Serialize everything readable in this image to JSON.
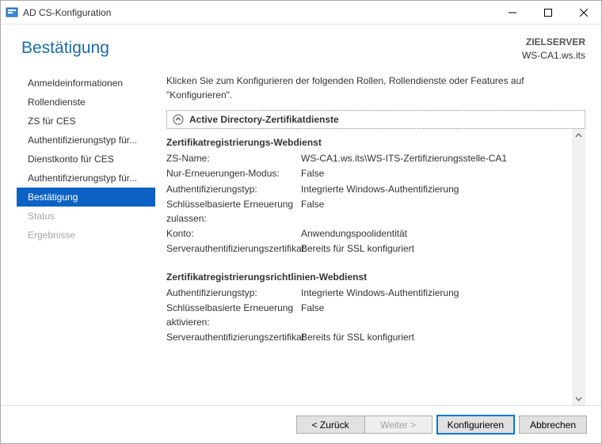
{
  "window": {
    "title": "AD CS-Konfiguration"
  },
  "header": {
    "page_title": "Bestätigung",
    "target_label": "ZIELSERVER",
    "target_value": "WS-CA1.ws.its"
  },
  "sidebar": {
    "items": [
      {
        "label": "Anmeldeinformationen"
      },
      {
        "label": "Rollendienste"
      },
      {
        "label": "ZS für CES"
      },
      {
        "label": "Authentifizierungstyp für..."
      },
      {
        "label": "Dienstkonto für CES"
      },
      {
        "label": "Authentifizierungstyp für..."
      },
      {
        "label": "Bestätigung"
      },
      {
        "label": "Status"
      },
      {
        "label": "Ergebnisse"
      }
    ]
  },
  "content": {
    "intro": "Klicken Sie zum Konfigurieren der folgenden Rollen, Rollendienste oder Features auf \"Konfigurieren\".",
    "group_title": "Active Directory-Zertifikatdienste",
    "section1": {
      "title": "Zertifikatregistrierungs-Webdienst",
      "rows": [
        {
          "k": "ZS-Name:",
          "v": "WS-CA1.ws.its\\WS-ITS-Zertifizierungsstelle-CA1"
        },
        {
          "k": "Nur-Erneuerungen-Modus:",
          "v": "False"
        },
        {
          "k": "Authentifizierungstyp:",
          "v": "Integrierte Windows-Authentifizierung"
        },
        {
          "k": "Schlüsselbasierte Erneuerung zulassen:",
          "v": "False"
        },
        {
          "k": "Konto:",
          "v": "Anwendungspoolidentität"
        },
        {
          "k": "Serverauthentifizierungszertifikat:",
          "v": "Bereits für SSL konfiguriert"
        }
      ]
    },
    "section2": {
      "title": "Zertifikatregistrierungsrichtlinien-Webdienst",
      "rows": [
        {
          "k": "Authentifizierungstyp:",
          "v": "Integrierte Windows-Authentifizierung"
        },
        {
          "k": "Schlüsselbasierte Erneuerung aktivieren:",
          "v": "False"
        },
        {
          "k": "Serverauthentifizierungszertifikat:",
          "v": "Bereits für SSL konfiguriert"
        }
      ]
    }
  },
  "footer": {
    "back": "< Zurück",
    "next": "Weiter >",
    "configure": "Konfigurieren",
    "cancel": "Abbrechen"
  }
}
